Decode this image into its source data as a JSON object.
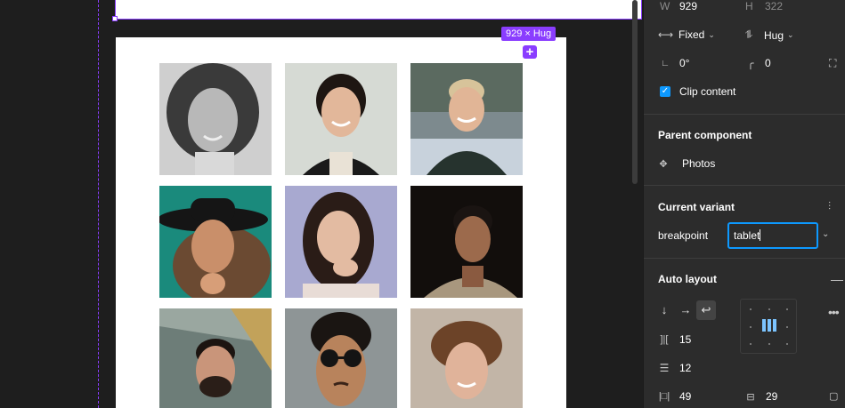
{
  "canvas": {
    "size_badge": "929 × Hug",
    "add_symbol": "+",
    "photos": [
      {
        "name": "woman-curly-hair-bw"
      },
      {
        "name": "woman-braids-apron"
      },
      {
        "name": "man-blond-jacket"
      },
      {
        "name": "woman-black-hat"
      },
      {
        "name": "woman-long-hair-hand-on-chin"
      },
      {
        "name": "man-dark-background"
      },
      {
        "name": "man-beard-glass-building"
      },
      {
        "name": "man-round-sunglasses"
      },
      {
        "name": "man-wavy-hair"
      }
    ]
  },
  "panel": {
    "w_label": "W",
    "w_value": "929",
    "h_label": "H",
    "h_value": "322",
    "width_mode": "Fixed",
    "height_mode": "Hug",
    "rotation": "0°",
    "radius": "0",
    "clip_content_label": "Clip content",
    "parent_component_title": "Parent component",
    "parent_component_name": "Photos",
    "current_variant_title": "Current variant",
    "variant_property": "breakpoint",
    "variant_value": "tablet",
    "auto_layout_title": "Auto layout",
    "gap_horizontal": "15",
    "gap_vertical": "12",
    "padding_horizontal": "49",
    "padding_vertical": "29",
    "colors": {
      "accent_purple": "#8a3dff",
      "accent_blue": "#0d99ff",
      "panel_bg": "#2c2c2c",
      "canvas_bg": "#1e1e1e"
    }
  }
}
